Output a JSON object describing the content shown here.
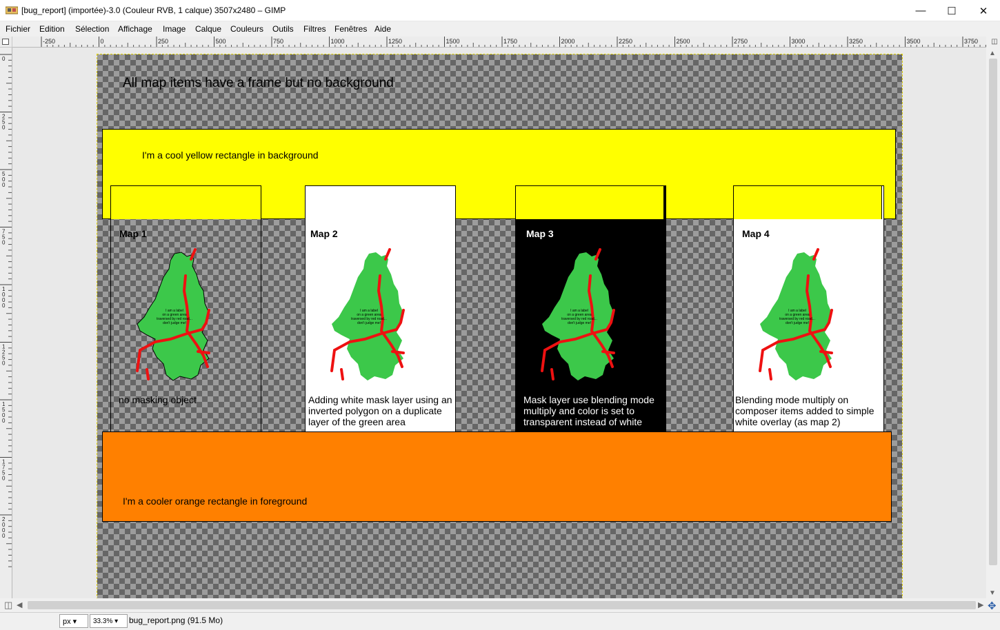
{
  "window": {
    "title": "[bug_report] (importée)-3.0 (Couleur RVB, 1 calque) 3507x2480 – GIMP",
    "minimize": "—",
    "maximize": "☐",
    "close": "✕"
  },
  "menu": [
    "Fichier",
    "Edition",
    "Sélection",
    "Affichage",
    "Image",
    "Calque",
    "Couleurs",
    "Outils",
    "Filtres",
    "Fenêtres",
    "Aide"
  ],
  "ruler": {
    "h_ticks": [
      "-250",
      "0",
      "250",
      "500",
      "750",
      "1000",
      "1250",
      "1500",
      "1750",
      "2000",
      "2250",
      "2500",
      "2750",
      "3000",
      "3250",
      "3500",
      "3750"
    ],
    "v_ticks": [
      "0",
      "250",
      "500",
      "750",
      "1000",
      "1250",
      "1500",
      "1750",
      "2000"
    ]
  },
  "canvas": {
    "heading": "All map items have a frame but no background",
    "yellow_label": "I'm a cool yellow rectangle in background",
    "orange_label": "I'm a cooler orange rectangle in foreground",
    "island_label": [
      "I am a label",
      "on a green area",
      "traversed by red road...",
      "don't judge me!"
    ],
    "maps": [
      {
        "title": "Map 1",
        "desc": "no masking object"
      },
      {
        "title": "Map 2",
        "desc": "Adding white mask layer using an inverted polygon on a duplicate layer of the green area"
      },
      {
        "title": "Map 3",
        "desc": "Mask layer use blending mode multiply and color is set to transparent instead of white"
      },
      {
        "title": "Map 4",
        "desc": "Blending mode multiply on composer items added to simple white overlay (as map 2)"
      }
    ],
    "colors": {
      "yellow": "#ffff00",
      "orange": "#ff8000",
      "green": "#3cc84a",
      "road": "#ee1111"
    }
  },
  "status": {
    "unit": "px",
    "zoom": "33.3%",
    "file_info": "bug_report.png (91.5 Mo)"
  }
}
